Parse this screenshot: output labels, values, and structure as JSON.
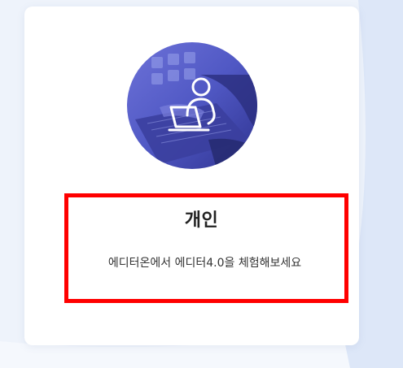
{
  "card": {
    "icon": "person-laptop-icon",
    "title": "개인",
    "description": "에디터온에서 에디터4.0을 체험해보세요"
  },
  "colors": {
    "background": "#eef3fb",
    "card": "#ffffff",
    "highlight_border": "#ff0000",
    "avatar_overlay": "#4a55c8"
  }
}
